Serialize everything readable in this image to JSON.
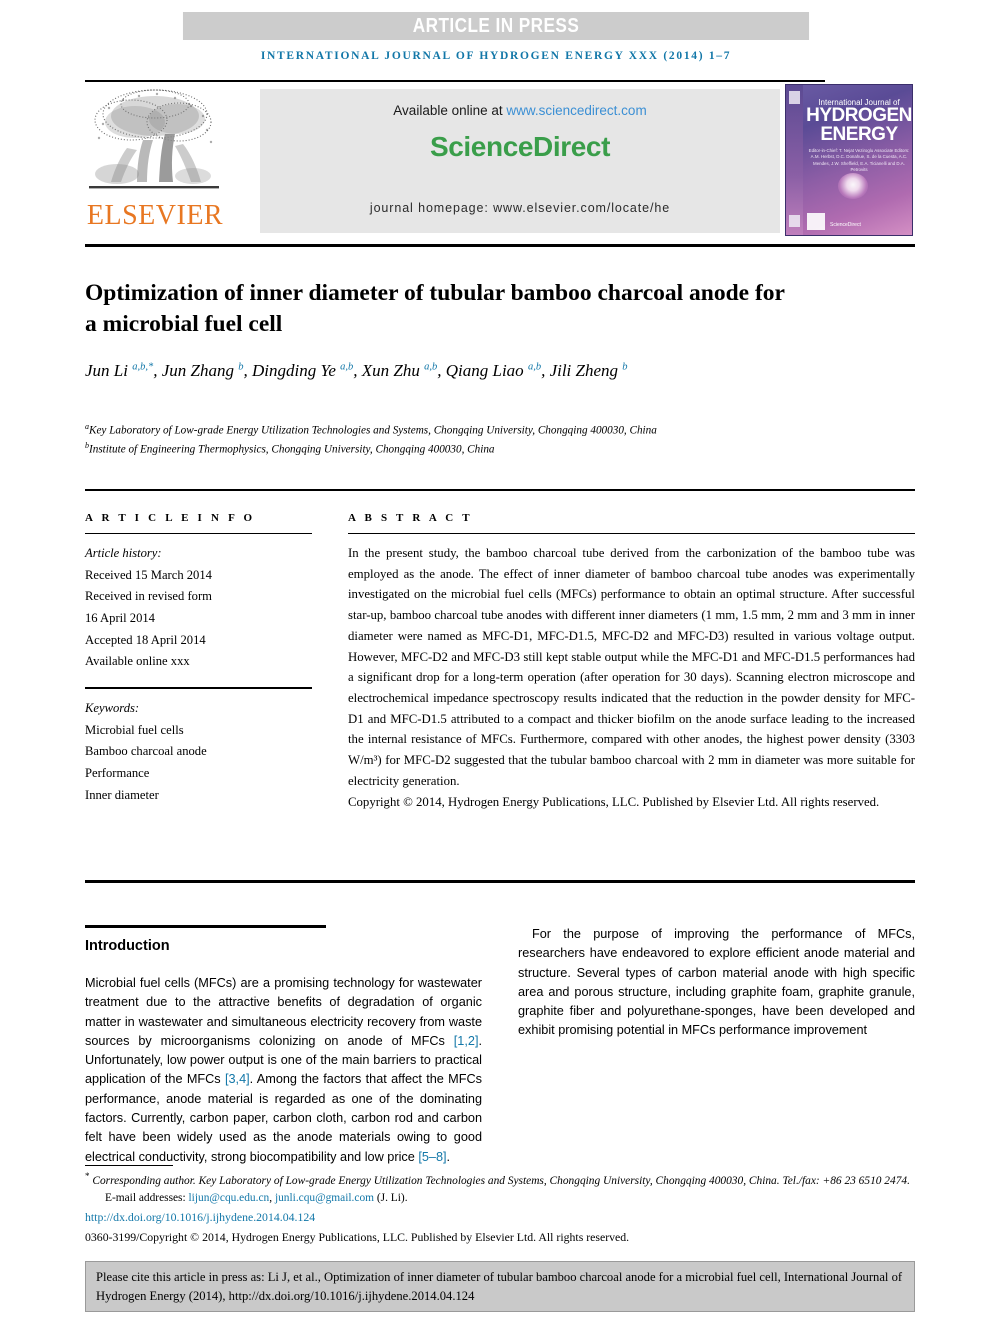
{
  "banner": {
    "text": "ARTICLE IN PRESS"
  },
  "running_head": {
    "text": "International Journal of Hydrogen Energy xxx (2014) 1–7"
  },
  "publisher": {
    "elsevier_wordmark": "ELSEVIER",
    "available_prefix": "Available online at ",
    "available_url": "www.sciencedirect.com",
    "sciencedirect_wordmark": "ScienceDirect",
    "homepage": "journal homepage: www.elsevier.com/locate/he"
  },
  "cover": {
    "line1": "International Journal of",
    "line2": "HYDROGEN\nENERGY",
    "editors": "Editor-in-Chief: T. Nejat Veziroglu\nAssociate Editors: A.M. Herbst, D.C. Donahue, S. de la Cuesta,\nA.C. Mendes, J.W. Sheffield,\nE.A. Ticianelli and D.A. Petrovits",
    "sd_mini": "ScienceDirect"
  },
  "title": "Optimization of inner diameter of tubular bamboo charcoal anode for a microbial fuel cell",
  "authors_html": "Jun Li <sup>a,b,*</sup>, Jun Zhang <sup>b</sup>, Dingding Ye <sup>a,b</sup>, Xun Zhu <sup>a,b</sup>, Qiang Liao <sup>a,b</sup>, Jili Zheng <sup>b</sup>",
  "affiliations": [
    {
      "marker": "a",
      "text": "Key Laboratory of Low-grade Energy Utilization Technologies and Systems, Chongqing University, Chongqing 400030, China"
    },
    {
      "marker": "b",
      "text": "Institute of Engineering Thermophysics, Chongqing University, Chongqing 400030, China"
    }
  ],
  "article_info": {
    "label": "A R T I C L E  I N F O",
    "history_head": "Article history:",
    "history": [
      "Received 15 March 2014",
      "Received in revised form",
      "16 April 2014",
      "Accepted 18 April 2014",
      "Available online xxx"
    ],
    "keywords_head": "Keywords:",
    "keywords": [
      "Microbial fuel cells",
      "Bamboo charcoal anode",
      "Performance",
      "Inner diameter"
    ]
  },
  "abstract": {
    "label": "A B S T R A C T",
    "body": "In the present study, the bamboo charcoal tube derived from the carbonization of the bamboo tube was employed as the anode. The effect of inner diameter of bamboo charcoal tube anodes was experimentally investigated on the microbial fuel cells (MFCs) performance to obtain an optimal structure. After successful star-up, bamboo charcoal tube anodes with different inner diameters (1 mm, 1.5 mm, 2 mm and 3 mm in inner diameter were named as MFC-D1, MFC-D1.5, MFC-D2 and MFC-D3) resulted in various voltage output. However, MFC-D2 and MFC-D3 still kept stable output while the MFC-D1 and MFC-D1.5 performances had a significant drop for a long-term operation (after operation for 30 days). Scanning electron microscope and electrochemical impedance spectroscopy results indicated that the reduction in the powder density for MFC-D1 and MFC-D1.5 attributed to a compact and thicker biofilm on the anode surface leading to the increased the internal resistance of MFCs. Furthermore, compared with other anodes, the highest power density (3303 W/m³) for MFC-D2 suggested that the tubular bamboo charcoal with 2 mm in diameter was more suitable for electricity generation.",
    "copyright": "Copyright © 2014, Hydrogen Energy Publications, LLC. Published by Elsevier Ltd. All rights reserved."
  },
  "introduction": {
    "heading": "Introduction",
    "left_p1_a": "Microbial fuel cells (MFCs) are a promising technology for wastewater treatment due to the attractive benefits of degradation of organic matter in wastewater and simultaneous electricity recovery from waste sources by microorganisms colonizing on anode of MFCs ",
    "left_ref1": "[1,2]",
    "left_p1_b": ". Unfortunately, low power output is one of the main barriers to practical application of the MFCs ",
    "left_ref2": "[3,4]",
    "left_p1_c": ". Among the factors that affect the MFCs performance, anode material is regarded as one of the dominating factors. Currently, carbon paper, carbon cloth, carbon rod and carbon felt have been widely used as the anode materials owing to good electrical conductivity, strong biocompatibility and low price ",
    "right_ref3": "[5–8]",
    "right_p1_end": ".",
    "right_p2": "For the purpose of improving the performance of MFCs, researchers have endeavored to explore efficient anode material and structure. Several types of carbon material anode with high specific area and porous structure, including graphite foam, graphite granule, graphite fiber and polyurethane-sponges, have been developed and exhibit promising potential in MFCs performance improvement"
  },
  "footnotes": {
    "corresponding": "Corresponding author. Key Laboratory of Low-grade Energy Utilization Technologies and Systems, Chongqing University, Chongqing 400030, China. Tel./fax: +86 23 6510 2474.",
    "email_label": "E-mail addresses: ",
    "email1": "lijun@cqu.edu.cn",
    "email_sep": ", ",
    "email2": "junli.cqu@gmail.com",
    "email_suffix": " (J. Li).",
    "doi": "http://dx.doi.org/10.1016/j.ijhydene.2014.04.124",
    "issn": "0360-3199/Copyright © 2014, Hydrogen Energy Publications, LLC. Published by Elsevier Ltd. All rights reserved."
  },
  "cite_box": {
    "text": "Please cite this article in press as: Li J, et al., Optimization of inner diameter of tubular bamboo charcoal anode for a microbial fuel cell, International Journal of Hydrogen Energy (2014), http://dx.doi.org/10.1016/j.ijhydene.2014.04.124"
  },
  "colors": {
    "banner_bg": "#cccccc",
    "running_head": "#1277a8",
    "link": "#1277a8",
    "elsevier_orange": "#e87722",
    "sciencedirect_green": "#3a9e4a",
    "sd_box_bg": "#e6e6e6",
    "cite_box_bg": "#c9c9c9"
  }
}
